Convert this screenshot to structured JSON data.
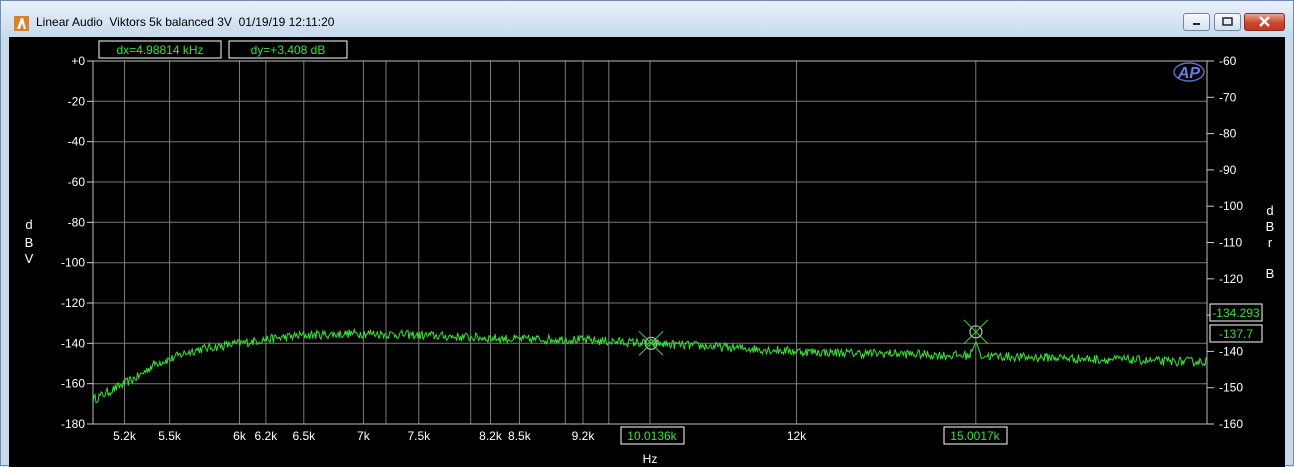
{
  "window": {
    "title": "Linear Audio  Viktors 5k balanced 3V  01/19/19 12:11:20",
    "icons": {
      "app": "ap-app-icon",
      "minimize": "minimize-icon",
      "maximize": "maximize-icon",
      "close": "close-icon"
    }
  },
  "readouts": {
    "dx": "dx=4.98814 kHz",
    "dy": "dy=+3.408  dB",
    "cursor1_x": "10.0136k",
    "cursor2_x": "15.0017k",
    "right_value_1": "-134.293",
    "right_value_2": "-137.7"
  },
  "logo": "AP",
  "colors": {
    "background": "#000000",
    "grid": "#808080",
    "trace": "#33e633",
    "readout_text": "#33e633",
    "axis_text": "#ffffff"
  },
  "chart_data": {
    "type": "line",
    "xlabel": "Hz",
    "ylabel": "dBV",
    "ylabel_right": "dBrB",
    "x_scale": "log",
    "xlim": [
      5000,
      20000
    ],
    "ylim": [
      -180,
      0
    ],
    "ylim_right": [
      -160,
      -60
    ],
    "x_ticks": [
      {
        "v": 5200,
        "label": "5.2k"
      },
      {
        "v": 5500,
        "label": "5.5k"
      },
      {
        "v": 6000,
        "label": "6k"
      },
      {
        "v": 6200,
        "label": "6.2k"
      },
      {
        "v": 6500,
        "label": "6.5k"
      },
      {
        "v": 7000,
        "label": "7k"
      },
      {
        "v": 7500,
        "label": "7.5k"
      },
      {
        "v": 8200,
        "label": "8.2k"
      },
      {
        "v": 8500,
        "label": "8.5k"
      },
      {
        "v": 9200,
        "label": "9.2k"
      },
      {
        "v": 12000,
        "label": "12k"
      }
    ],
    "x_gridlines": [
      5200,
      5500,
      6000,
      6200,
      6500,
      7000,
      7200,
      7500,
      8000,
      8200,
      8500,
      9000,
      9200,
      9500,
      10000,
      12000,
      15000
    ],
    "y_ticks_left": [
      {
        "v": 0,
        "label": "+0"
      },
      {
        "v": -20,
        "label": "-20"
      },
      {
        "v": -40,
        "label": "-40"
      },
      {
        "v": -60,
        "label": "-60"
      },
      {
        "v": -80,
        "label": "-80"
      },
      {
        "v": -100,
        "label": "-100"
      },
      {
        "v": -120,
        "label": "-120"
      },
      {
        "v": -140,
        "label": "-140"
      },
      {
        "v": -160,
        "label": "-160"
      },
      {
        "v": -180,
        "label": "-180"
      }
    ],
    "y_ticks_right": [
      {
        "v": -60,
        "label": "-60"
      },
      {
        "v": -70,
        "label": "-70"
      },
      {
        "v": -80,
        "label": "-80"
      },
      {
        "v": -90,
        "label": "-90"
      },
      {
        "v": -100,
        "label": "-100"
      },
      {
        "v": -110,
        "label": "-110"
      },
      {
        "v": -120,
        "label": "-120"
      },
      {
        "v": -130,
        "label": ""
      },
      {
        "v": -140,
        "label": "-140"
      },
      {
        "v": -150,
        "label": "-150"
      },
      {
        "v": -160,
        "label": "-160"
      }
    ],
    "series": [
      {
        "x": [
          5000,
          5100,
          5200,
          5300,
          5400,
          5500,
          5600,
          5700,
          5800,
          5900,
          6000,
          6200,
          6500,
          7000,
          7500,
          8000,
          8500,
          9000,
          9500,
          10000,
          10500,
          11000,
          11500,
          12000,
          12500,
          13000,
          13500,
          14000,
          14500,
          14900,
          15000,
          15100,
          15500,
          16000,
          16500,
          17000,
          17500,
          18000,
          18500,
          19000,
          19500,
          20000
        ],
        "y": [
          -168,
          -164,
          -160,
          -156,
          -150,
          -148,
          -145,
          -143,
          -142,
          -141,
          -140,
          -138,
          -136,
          -135,
          -136,
          -137,
          -138,
          -138,
          -139,
          -140,
          -141,
          -142,
          -143,
          -144,
          -144.5,
          -145,
          -145,
          -145.5,
          -146,
          -146,
          -139,
          -146,
          -146.5,
          -147,
          -147,
          -147.5,
          -148,
          -148,
          -148.5,
          -149,
          -149,
          -149
        ]
      }
    ],
    "cursors": [
      {
        "x": 10013.6,
        "y": -140
      },
      {
        "x": 15001.7,
        "y": -134.3
      }
    ]
  }
}
